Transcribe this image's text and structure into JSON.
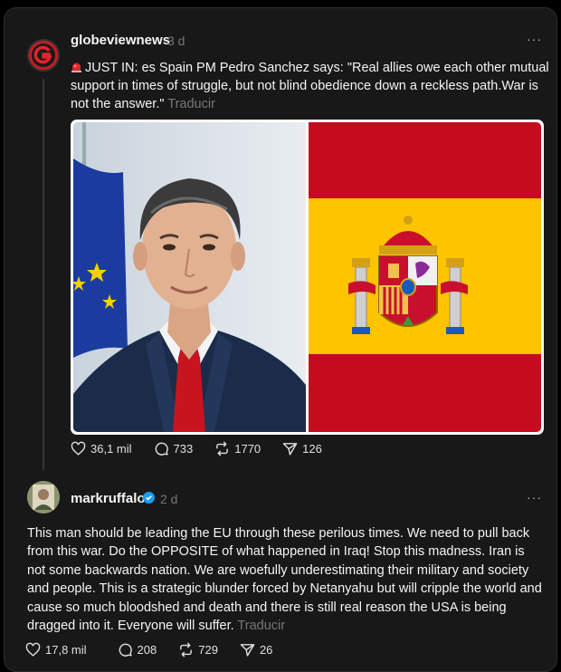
{
  "post1": {
    "username": "globeviewnews",
    "time": "3 d",
    "siren_icon": "siren-icon",
    "text": "JUST IN: es Spain PM Pedro Sanchez says: \"Real allies owe each other mutual support in times of struggle, but not blind obedience down a reckless path.War is not the answer.\"",
    "translate_label": "Traducir",
    "likes": "36,1 mil",
    "replies": "733",
    "reposts": "1770",
    "shares": "126"
  },
  "post2": {
    "username": "markruffalo",
    "time": "2 d",
    "text": "This man should be leading the EU through these perilous times. We need to pull back from this war. Do the OPPOSITE of what happened in Iraq! Stop this madness. Iran is not some backwards nation. We are woefully underestimating their military and society and people. This is a strategic blunder forced by Netanyahu but will cripple the world and cause so much bloodshed and death and there is still real reason the USA is being dragged into it. Everyone will suffer.",
    "translate_label": "Traducir",
    "likes": "17,8 mil",
    "replies": "208",
    "reposts": "729",
    "shares": "26"
  },
  "more_label": "···",
  "colors": {
    "background": "#181818",
    "text": "#f3f5f7",
    "muted": "#777777",
    "verified": "#1d9bf0",
    "flag_red": "#c60b1e",
    "flag_yellow": "#ffc400"
  }
}
